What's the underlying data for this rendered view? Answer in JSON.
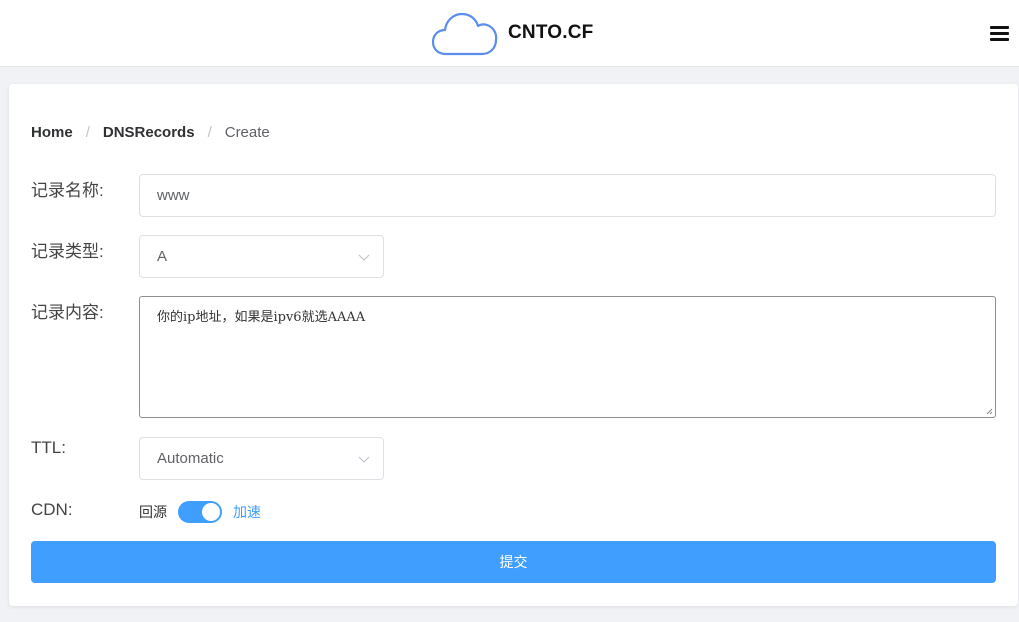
{
  "header": {
    "brand_name": "CNTO.CF",
    "logo_icon": "cloud-icon",
    "menu_icon": "hamburger-menu-icon"
  },
  "breadcrumb": {
    "home": "Home",
    "section": "DNSRecords",
    "current": "Create",
    "separator": "/"
  },
  "form": {
    "name_label": "记录名称:",
    "name_value": "www",
    "type_label": "记录类型:",
    "type_value": "A",
    "content_label": "记录内容:",
    "content_value": "你的ip地址，如果是ipv6就选AAAA",
    "ttl_label": "TTL:",
    "ttl_value": "Automatic",
    "cdn_label": "CDN:",
    "cdn_inactive_text": "回源",
    "cdn_active_text": "加速",
    "cdn_enabled": true,
    "submit_label": "提交"
  },
  "colors": {
    "primary": "#409eff",
    "logo_stroke": "#5b8def"
  }
}
